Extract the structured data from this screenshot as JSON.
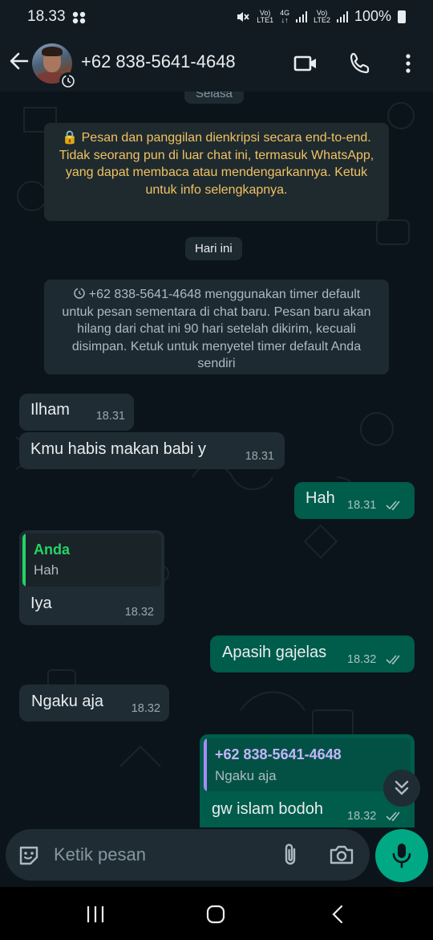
{
  "status_bar": {
    "time": "18.33",
    "battery": "100%",
    "sim1": "LTE1",
    "sim2": "LTE2",
    "net": "4G",
    "vo1": "Vo)",
    "vo2": "Vo)"
  },
  "header": {
    "contact_name": "+62 838-5641-4648"
  },
  "chat": {
    "date_prev": "Selasa",
    "encryption_notice": "🔒 Pesan dan panggilan dienkripsi secara end-to-end. Tidak seorang pun di luar chat ini, termasuk WhatsApp, yang dapat membaca atau mendengarkannya. Ketuk untuk info selengkapnya.",
    "date_today": "Hari ini",
    "timer_notice": "+62 838-5641-4648 menggunakan timer default untuk pesan sementara di chat baru. Pesan baru akan hilang dari chat ini 90 hari setelah dikirim, kecuali disimpan. Ketuk untuk menyetel timer default Anda sendiri",
    "messages": [
      {
        "text": "Ilham",
        "time": "18.31"
      },
      {
        "text": "Kmu habis makan babi y",
        "time": "18.31"
      },
      {
        "text": "Hah",
        "time": "18.31"
      },
      {
        "quote_name": "Anda",
        "quote_text": "Hah",
        "text": "Iya",
        "time": "18.32"
      },
      {
        "text": "Apasih gajelas",
        "time": "18.32"
      },
      {
        "text": "Ngaku aja",
        "time": "18.32"
      },
      {
        "quote_name": "+62 838-5641-4648",
        "quote_text": "Ngaku aja",
        "text": "gw islam bodoh",
        "time": "18.32"
      }
    ]
  },
  "composer": {
    "placeholder": "Ketik pesan"
  },
  "colors": {
    "incoming": "#1f2c34",
    "outgoing": "#005c4b",
    "accent": "#00a884",
    "quote_self": "#25d366",
    "quote_other": "#a78bfa",
    "encryption_text": "#f0c261"
  },
  "icons": [
    "back-arrow-icon",
    "timer-icon",
    "video-call-icon",
    "phone-icon",
    "more-vert-icon",
    "double-check-icon",
    "chevron-double-down-icon",
    "sticker-icon",
    "attach-icon",
    "camera-icon",
    "mic-icon",
    "nav-recents-icon",
    "nav-home-icon",
    "nav-back-icon"
  ]
}
